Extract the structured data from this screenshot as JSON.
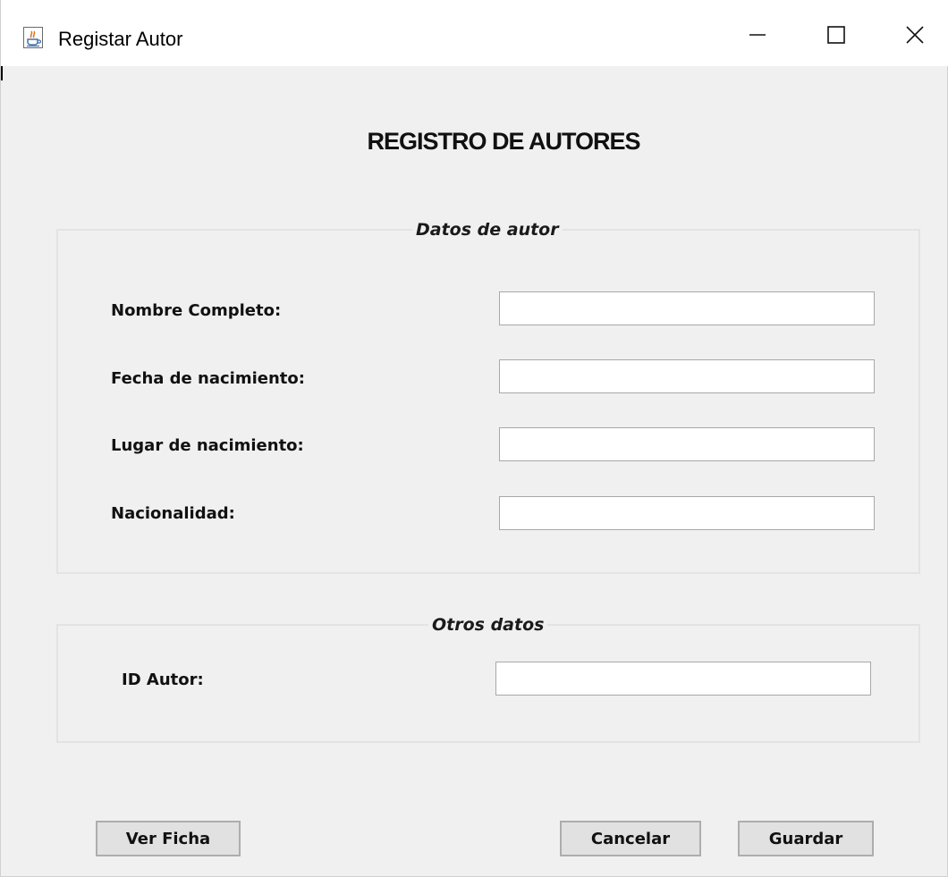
{
  "window": {
    "title": "Registar Autor",
    "icon": "java-cup-icon",
    "controls": [
      "minimize-icon",
      "maximize-icon",
      "close-icon"
    ]
  },
  "form": {
    "heading": "REGISTRO DE AUTORES",
    "author_group": {
      "legend": "Datos de autor",
      "fields": [
        {
          "label": "Nombre Completo:",
          "value": ""
        },
        {
          "label": "Fecha de nacimiento:",
          "value": ""
        },
        {
          "label": "Lugar de nacimiento:",
          "value": ""
        },
        {
          "label": "Nacionalidad:",
          "value": ""
        }
      ]
    },
    "other_group": {
      "legend": "Otros datos",
      "fields": [
        {
          "label": "ID Autor:",
          "value": ""
        }
      ]
    }
  },
  "buttons": {
    "view": "Ver Ficha",
    "cancel": "Cancelar",
    "save": "Guardar"
  }
}
